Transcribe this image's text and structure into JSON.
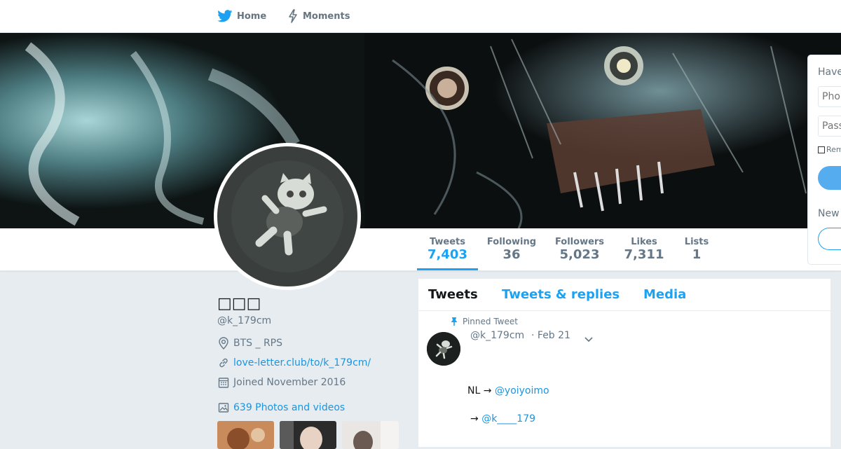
{
  "nav": {
    "home_label": "Home",
    "moments_label": "Moments"
  },
  "colors": {
    "accent": "#1da1f2",
    "link": "#1b95e0",
    "background": "#e6ecf0"
  },
  "stats": [
    {
      "label": "Tweets",
      "value": "7,403"
    },
    {
      "label": "Following",
      "value": "36"
    },
    {
      "label": "Followers",
      "value": "5,023"
    },
    {
      "label": "Likes",
      "value": "7,311"
    },
    {
      "label": "Lists",
      "value": "1"
    }
  ],
  "profile": {
    "name": "□□□",
    "handle": "@k_179cm",
    "location": "BTS _ RPS",
    "website": "love-letter.club/to/k_179cm/",
    "joined": "Joined November 2016",
    "photos": "639 Photos and videos"
  },
  "timeline": {
    "tabs": [
      "Tweets",
      "Tweets & replies",
      "Media"
    ],
    "pinned_label": "Pinned Tweet",
    "tweet": {
      "handle": "@k_179cm",
      "date": "· Feb 21",
      "line1_prefix": "NL → ",
      "line1_mention": "@yoiyoimo",
      "line2_prefix": "→  ",
      "line2_mention": "@k____179"
    }
  },
  "login": {
    "heading": "Have",
    "phone_placeholder": "Phone",
    "password_placeholder": "Password",
    "remember_label": "Rem",
    "new_label": "New"
  },
  "icons": {
    "home": "twitter-bird-icon",
    "moments": "lightning-icon",
    "location": "map-pin-icon",
    "website": "link-icon",
    "joined": "calendar-icon",
    "photos": "image-icon",
    "pin": "pin-icon",
    "caret": "chevron-down-icon"
  }
}
